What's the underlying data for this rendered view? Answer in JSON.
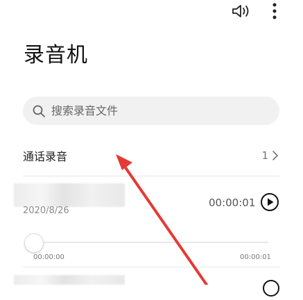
{
  "app": {
    "title": "录音机"
  },
  "toolbar": {
    "speaker_icon": "speaker-icon",
    "more_icon": "more-vertical-icon"
  },
  "search": {
    "placeholder": "搜索录音文件",
    "icon": "search-icon"
  },
  "category": {
    "label": "通话录音",
    "count": "1",
    "chevron_icon": "chevron-right-icon"
  },
  "recordings": [
    {
      "date": "2020/8/26",
      "duration": "00:00:01",
      "progress": 0,
      "elapsed": "00:00:00",
      "total": "00:00:01"
    }
  ],
  "colors": {
    "annotation_arrow": "#e53935",
    "search_bg": "#f1f1f1"
  }
}
